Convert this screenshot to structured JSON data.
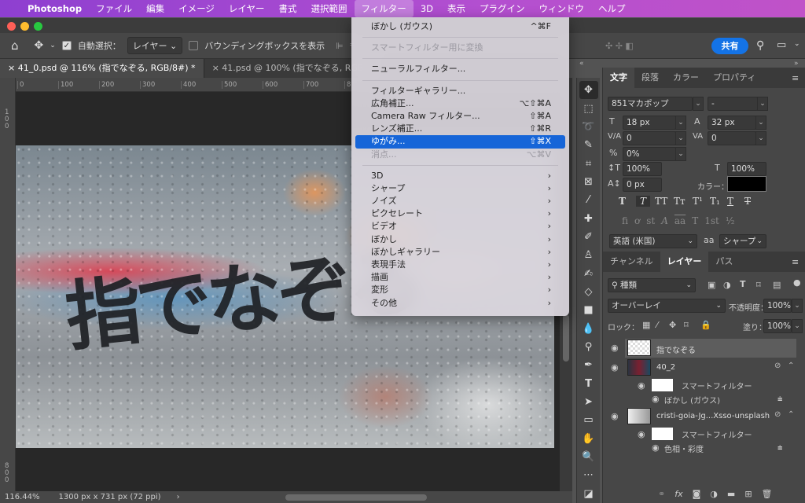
{
  "menubar": {
    "apple": "",
    "app": "Photoshop",
    "items": [
      "ファイル",
      "編集",
      "イメージ",
      "レイヤー",
      "書式",
      "選択範囲",
      "フィルター",
      "3D",
      "表示",
      "プラグイン",
      "ウィンドウ",
      "ヘルプ"
    ],
    "active": "フィルター"
  },
  "options": {
    "auto_select_label": "自動選択：",
    "auto_select_checked": true,
    "auto_select_target": "レイヤー",
    "bbox_label": "バウンディングボックスを表示",
    "bbox_checked": false,
    "share": "共有"
  },
  "tabs": [
    {
      "label": "41_0.psd @ 116% (指でなぞる, RGB/8#) *",
      "active": true
    },
    {
      "label": "41.psd @ 100% (指でなぞる, RGB/8#)",
      "active": false
    }
  ],
  "rulers": {
    "h": [
      "0",
      "100",
      "200",
      "300",
      "400",
      "500",
      "600",
      "700",
      "8"
    ],
    "v": [
      "1 0 0",
      "8 0 0"
    ]
  },
  "canvas": {
    "text": "指でなぞる"
  },
  "status": {
    "zoom": "116.44%",
    "doc_info": "1300 px x 731 px (72 ppi)"
  },
  "filter_menu": {
    "groups": [
      [
        {
          "label": "ぼかし (ガウス)",
          "shortcut": "^⌘F"
        }
      ],
      [
        {
          "label": "スマートフィルター用に変換",
          "disabled": true
        }
      ],
      [
        {
          "label": "ニューラルフィルター..."
        }
      ],
      [
        {
          "label": "フィルターギャラリー..."
        },
        {
          "label": "広角補正...",
          "shortcut": "⌥⇧⌘A"
        },
        {
          "label": "Camera Raw フィルター...",
          "shortcut": "⇧⌘A"
        },
        {
          "label": "レンズ補正...",
          "shortcut": "⇧⌘R"
        },
        {
          "label": "ゆがみ...",
          "shortcut": "⇧⌘X",
          "highlighted": true
        },
        {
          "label": "消点...",
          "shortcut": "⌥⌘V",
          "disabled": true
        }
      ],
      [
        {
          "label": "3D",
          "submenu": true
        },
        {
          "label": "シャープ",
          "submenu": true
        },
        {
          "label": "ノイズ",
          "submenu": true
        },
        {
          "label": "ピクセレート",
          "submenu": true
        },
        {
          "label": "ビデオ",
          "submenu": true
        },
        {
          "label": "ぼかし",
          "submenu": true
        },
        {
          "label": "ぼかしギャラリー",
          "submenu": true
        },
        {
          "label": "表現手法",
          "submenu": true
        },
        {
          "label": "描画",
          "submenu": true
        },
        {
          "label": "変形",
          "submenu": true
        },
        {
          "label": "その他",
          "submenu": true
        }
      ]
    ]
  },
  "character_panel": {
    "tabs": [
      "文字",
      "段落",
      "カラー",
      "プロパティ"
    ],
    "font": "851マカポップ",
    "style": "-",
    "size": "18 px",
    "leading": "32 px",
    "kerning": "0",
    "tracking": "0",
    "tsume": "0%",
    "vscale": "100%",
    "hscale": "100%",
    "baseline": "0 px",
    "color_label": "カラー：",
    "color": "#000000",
    "style_buttons": [
      "T",
      "T",
      "TT",
      "Tт",
      "T¹",
      "T₁",
      "T",
      "T"
    ],
    "opentype_buttons": [
      "ﬁ",
      "ơ",
      "st",
      "A",
      "aa",
      "T",
      "1st",
      "½"
    ],
    "language": "英語 (米国)",
    "aa_label": "aa",
    "antialias": "シャープ"
  },
  "layers_panel": {
    "tabs": [
      "チャンネル",
      "レイヤー",
      "パス"
    ],
    "filter_kind": "種類",
    "blend_mode": "オーバーレイ",
    "opacity_label": "不透明度：",
    "opacity": "100%",
    "lock_label": "ロック：",
    "fill_label": "塗り：",
    "fill": "100%",
    "layers": [
      {
        "name": "指でなぞる",
        "selected": true
      },
      {
        "name": "40_2",
        "smart_filter": "スマートフィルター",
        "filter": "ぼかし (ガウス)"
      },
      {
        "name": "cristi-goia-Jg...Xsso-unsplash",
        "smart_filter": "スマートフィルター",
        "filter": "色相・彩度"
      }
    ]
  },
  "colors": {
    "menubar": "#a348d0",
    "accent": "#1473e6",
    "highlight": "#1665d8"
  }
}
